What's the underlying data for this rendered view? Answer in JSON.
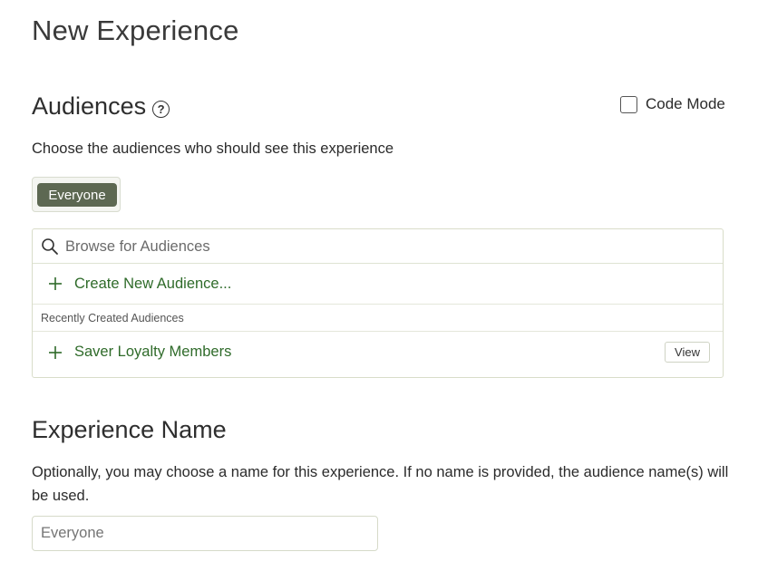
{
  "page": {
    "title": "New Experience"
  },
  "audiences": {
    "title": "Audiences",
    "help_icon": "question-circle-icon",
    "code_mode_label": "Code Mode",
    "code_mode_checked": false,
    "description": "Choose the audiences who should see this experience",
    "selected_chip": "Everyone",
    "search": {
      "placeholder": "Browse for Audiences",
      "value": ""
    },
    "create_label": "Create New Audience...",
    "recent_header": "Recently Created Audiences",
    "recent_items": [
      {
        "label": "Saver Loyalty Members",
        "view_label": "View"
      }
    ]
  },
  "experience_name": {
    "title": "Experience Name",
    "description": "Optionally, you may choose a name for this experience. If no name is provided, the audience name(s) will be used.",
    "input_value": "",
    "input_placeholder": "Everyone"
  },
  "colors": {
    "accent_green": "#2f6b2a",
    "chip_bg": "#5d6852",
    "border": "#d9ddc9"
  }
}
